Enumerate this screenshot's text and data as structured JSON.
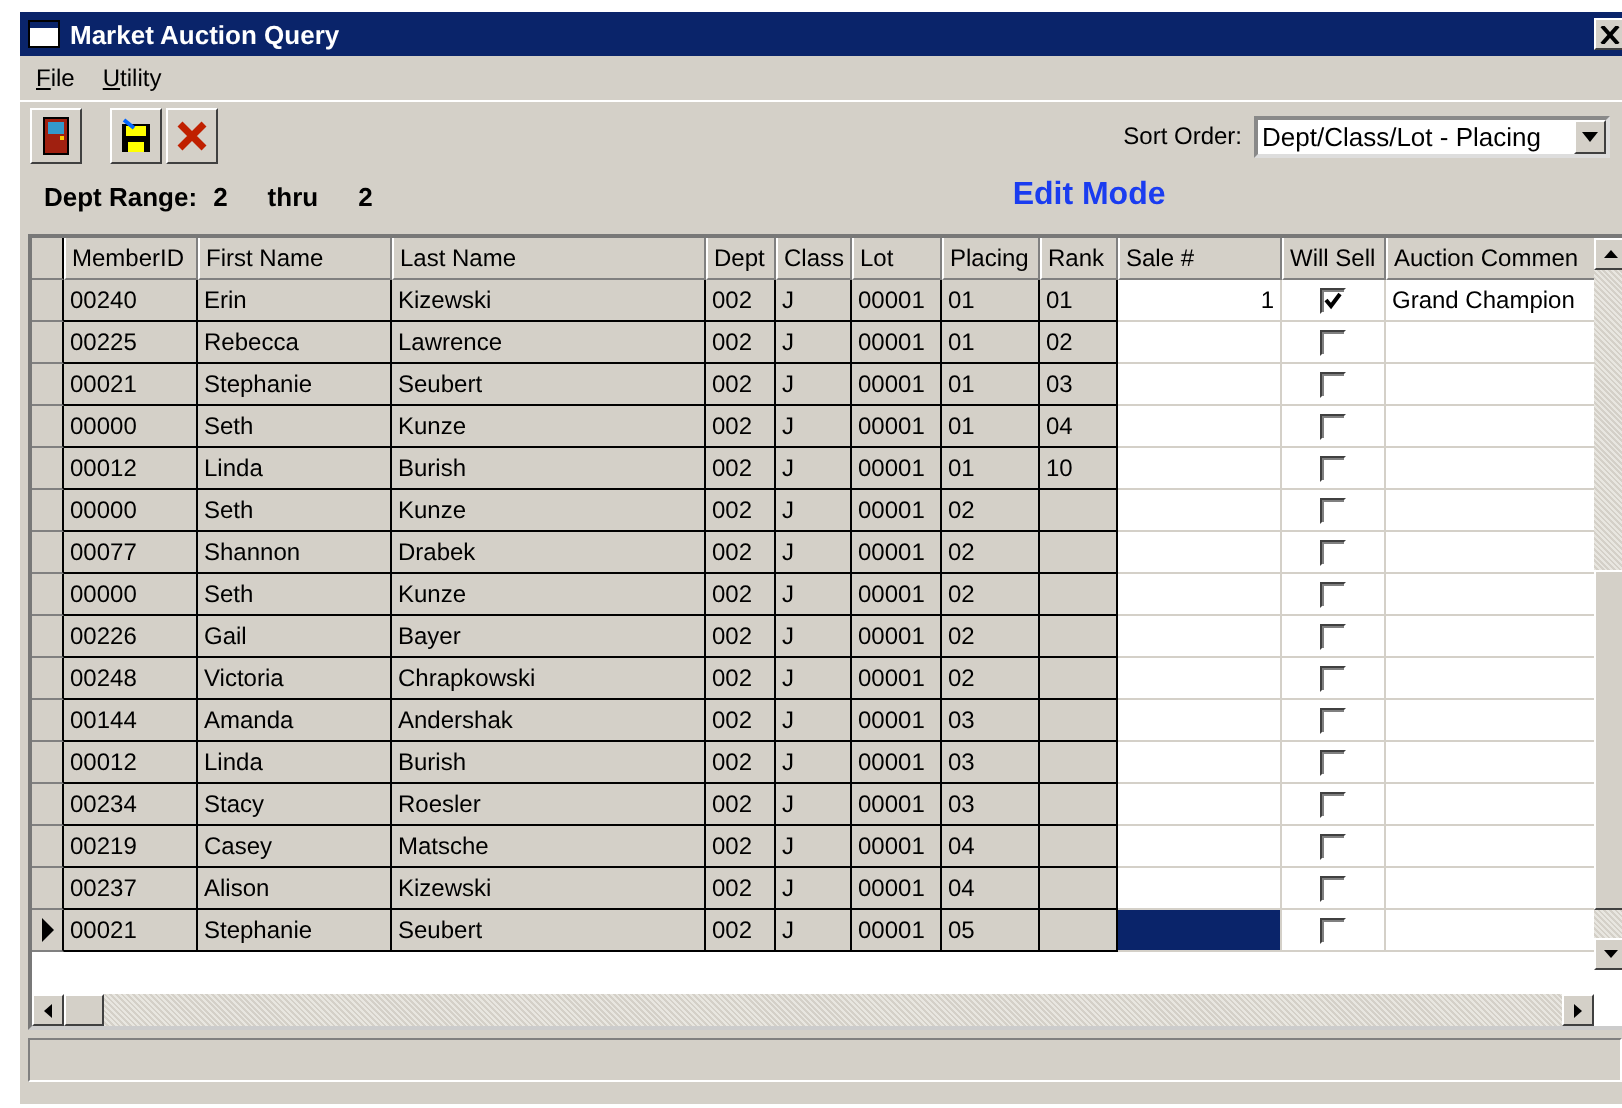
{
  "window": {
    "title": "Market Auction Query"
  },
  "menu": [
    {
      "label": "File"
    },
    {
      "label": "Utility"
    }
  ],
  "sort": {
    "label": "Sort Order:",
    "value": "Dept/Class/Lot - Placing"
  },
  "range": {
    "label": "Dept Range:",
    "from": "2",
    "thru": "thru",
    "to": "2"
  },
  "mode": "Edit Mode",
  "table": {
    "columns": [
      "MemberID",
      "First Name",
      "Last Name",
      "Dept",
      "Class",
      "Lot",
      "Placing",
      "Rank",
      "Sale #",
      "Will Sell",
      "Auction Commen"
    ],
    "rows": [
      {
        "member_id": "00240",
        "first": "Erin",
        "last": "Kizewski",
        "dept": "002",
        "class": "J",
        "lot": "00001",
        "placing": "01",
        "rank": "01",
        "sale": "1",
        "will_sell": true,
        "comment": "Grand Champion",
        "current": false
      },
      {
        "member_id": "00225",
        "first": "Rebecca",
        "last": "Lawrence",
        "dept": "002",
        "class": "J",
        "lot": "00001",
        "placing": "01",
        "rank": "02",
        "will_sell": false,
        "current": false
      },
      {
        "member_id": "00021",
        "first": "Stephanie",
        "last": "Seubert",
        "dept": "002",
        "class": "J",
        "lot": "00001",
        "placing": "01",
        "rank": "03",
        "will_sell": false,
        "current": false
      },
      {
        "member_id": "00000",
        "first": "Seth",
        "last": "Kunze",
        "dept": "002",
        "class": "J",
        "lot": "00001",
        "placing": "01",
        "rank": "04",
        "will_sell": false,
        "current": false
      },
      {
        "member_id": "00012",
        "first": "Linda",
        "last": "Burish",
        "dept": "002",
        "class": "J",
        "lot": "00001",
        "placing": "01",
        "rank": "10",
        "will_sell": false,
        "current": false
      },
      {
        "member_id": "00000",
        "first": "Seth",
        "last": "Kunze",
        "dept": "002",
        "class": "J",
        "lot": "00001",
        "placing": "02",
        "will_sell": false,
        "current": false
      },
      {
        "member_id": "00077",
        "first": "Shannon",
        "last": "Drabek",
        "dept": "002",
        "class": "J",
        "lot": "00001",
        "placing": "02",
        "will_sell": false,
        "current": false
      },
      {
        "member_id": "00000",
        "first": "Seth",
        "last": "Kunze",
        "dept": "002",
        "class": "J",
        "lot": "00001",
        "placing": "02",
        "will_sell": false,
        "current": false
      },
      {
        "member_id": "00226",
        "first": "Gail",
        "last": "Bayer",
        "dept": "002",
        "class": "J",
        "lot": "00001",
        "placing": "02",
        "will_sell": false,
        "current": false
      },
      {
        "member_id": "00248",
        "first": "Victoria",
        "last": "Chrapkowski",
        "dept": "002",
        "class": "J",
        "lot": "00001",
        "placing": "02",
        "will_sell": false,
        "current": false
      },
      {
        "member_id": "00144",
        "first": "Amanda",
        "last": "Andershak",
        "dept": "002",
        "class": "J",
        "lot": "00001",
        "placing": "03",
        "will_sell": false,
        "current": false
      },
      {
        "member_id": "00012",
        "first": "Linda",
        "last": "Burish",
        "dept": "002",
        "class": "J",
        "lot": "00001",
        "placing": "03",
        "will_sell": false,
        "current": false
      },
      {
        "member_id": "00234",
        "first": "Stacy",
        "last": "Roesler",
        "dept": "002",
        "class": "J",
        "lot": "00001",
        "placing": "03",
        "will_sell": false,
        "current": false
      },
      {
        "member_id": "00219",
        "first": "Casey",
        "last": "Matsche",
        "dept": "002",
        "class": "J",
        "lot": "00001",
        "placing": "04",
        "will_sell": false,
        "current": false
      },
      {
        "member_id": "00237",
        "first": "Alison",
        "last": "Kizewski",
        "dept": "002",
        "class": "J",
        "lot": "00001",
        "placing": "04",
        "will_sell": false,
        "current": false
      },
      {
        "member_id": "00021",
        "first": "Stephanie",
        "last": "Seubert",
        "dept": "002",
        "class": "J",
        "lot": "00001",
        "placing": "05",
        "will_sell": false,
        "current": true
      }
    ]
  }
}
